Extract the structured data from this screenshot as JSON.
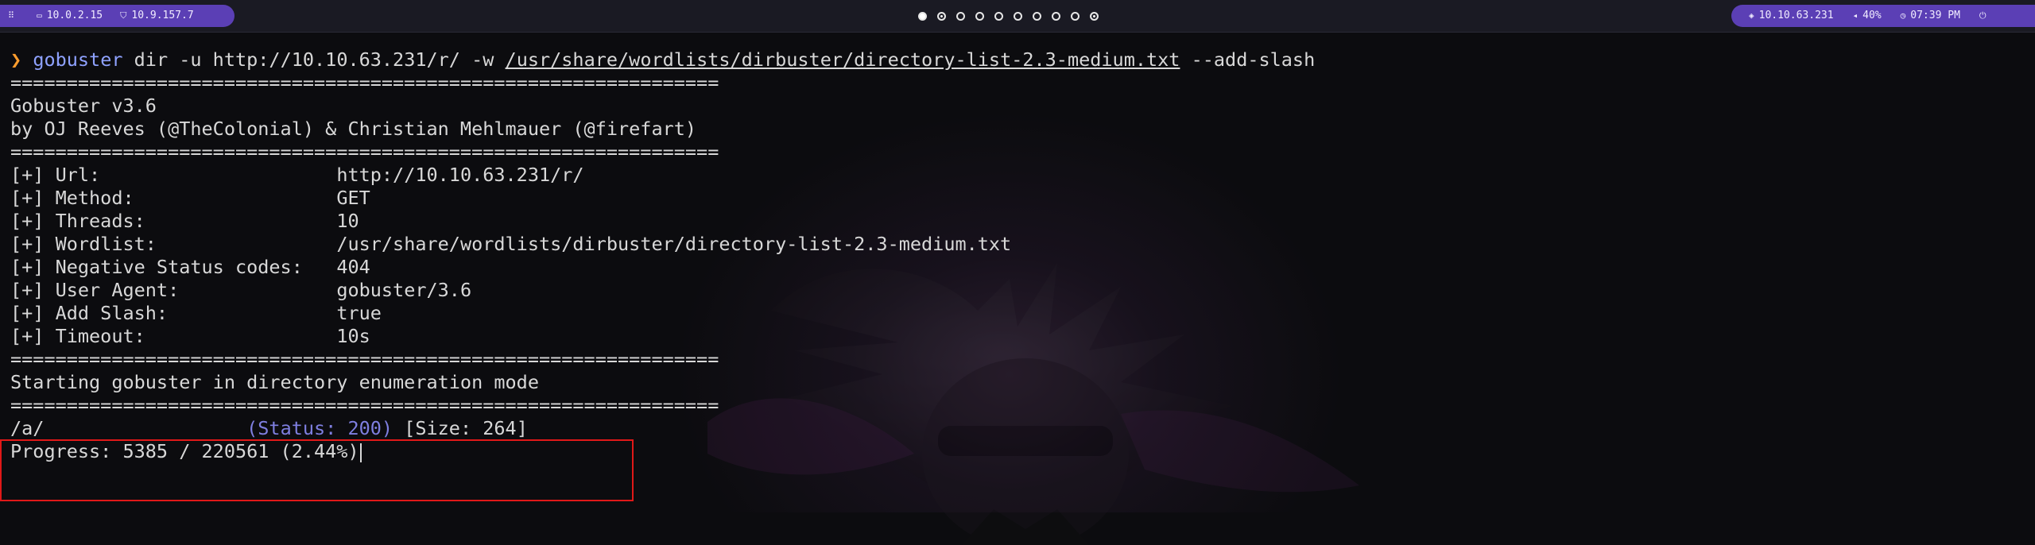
{
  "topbar": {
    "left": {
      "menu_icon": "grid-icon",
      "ip1": "10.0.2.15",
      "ip2": "10.9.157.7"
    },
    "workspaces": [
      "filled",
      "current",
      "empty",
      "empty",
      "empty",
      "empty",
      "empty",
      "empty",
      "empty",
      "current"
    ],
    "right": {
      "target_ip": "10.10.63.231",
      "volume": "40%",
      "time": "07:39 PM"
    }
  },
  "terminal": {
    "prompt": "❯",
    "command_name": "gobuster",
    "command_args_1": " dir -u http://10.10.63.231/r/ -w ",
    "command_wordlist": "/usr/share/wordlists/dirbuster/directory-list-2.3-medium.txt",
    "command_args_2": " --add-slash",
    "separator": "===============================================================",
    "banner_version": "Gobuster v3.6",
    "banner_authors": "by OJ Reeves (@TheColonial) & Christian Mehlmauer (@firefart)",
    "config": [
      {
        "key": "[+] Url:                     ",
        "value": "http://10.10.63.231/r/"
      },
      {
        "key": "[+] Method:                  ",
        "value": "GET"
      },
      {
        "key": "[+] Threads:                 ",
        "value": "10"
      },
      {
        "key": "[+] Wordlist:                ",
        "value": "/usr/share/wordlists/dirbuster/directory-list-2.3-medium.txt"
      },
      {
        "key": "[+] Negative Status codes:   ",
        "value": "404"
      },
      {
        "key": "[+] User Agent:              ",
        "value": "gobuster/3.6"
      },
      {
        "key": "[+] Add Slash:               ",
        "value": "true"
      },
      {
        "key": "[+] Timeout:                 ",
        "value": "10s"
      }
    ],
    "starting_message": "Starting gobuster in directory enumeration mode",
    "result": {
      "path": "/a/                  ",
      "status": "(Status: 200)",
      "size": " [Size: 264]"
    },
    "progress": "Progress: 5385 / 220561 (2.44%)"
  }
}
